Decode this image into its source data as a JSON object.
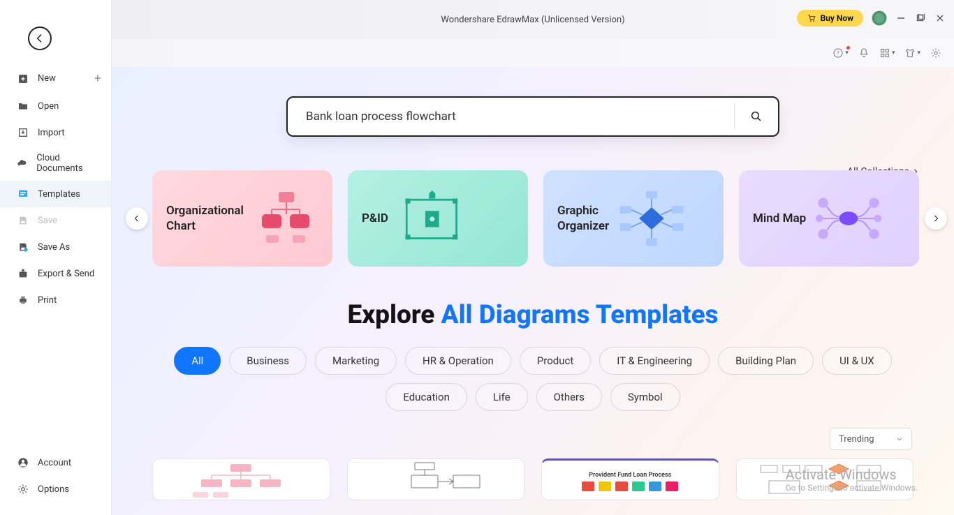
{
  "app_title": "Wondershare EdrawMax (Unlicensed Version)",
  "buy_label": "Buy Now",
  "sidebar": {
    "items": [
      {
        "label": "New",
        "icon": "plus-box",
        "plus": true
      },
      {
        "label": "Open",
        "icon": "folder"
      },
      {
        "label": "Import",
        "icon": "import"
      },
      {
        "label": "Cloud Documents",
        "icon": "cloud"
      },
      {
        "label": "Templates",
        "icon": "template",
        "active": true
      },
      {
        "label": "Save",
        "icon": "save",
        "disabled": true
      },
      {
        "label": "Save As",
        "icon": "save-as"
      },
      {
        "label": "Export & Send",
        "icon": "export"
      },
      {
        "label": "Print",
        "icon": "print"
      }
    ],
    "bottom": [
      {
        "label": "Account",
        "icon": "account"
      },
      {
        "label": "Options",
        "icon": "gear"
      }
    ]
  },
  "search": {
    "value": "Bank loan process flowchart"
  },
  "collections_link": "All Collections",
  "carousel": [
    {
      "label": "Organizational Chart",
      "variant": "pink"
    },
    {
      "label": "P&ID",
      "variant": "teal"
    },
    {
      "label": "Graphic Organizer",
      "variant": "blue"
    },
    {
      "label": "Mind Map",
      "variant": "purple"
    }
  ],
  "explore": {
    "prefix": "Explore ",
    "suffix": "All Diagrams Templates"
  },
  "pills": [
    "All",
    "Business",
    "Marketing",
    "HR & Operation",
    "Product",
    "IT & Engineering",
    "Building Plan",
    "UI & UX",
    "Education",
    "Life",
    "Others",
    "Symbol"
  ],
  "active_pill": "All",
  "sort_label": "Trending",
  "result3_title": "Provident Fund Loan Process",
  "watermark": {
    "line1": "Activate Windows",
    "line2": "Go to Settings to activate Windows."
  }
}
